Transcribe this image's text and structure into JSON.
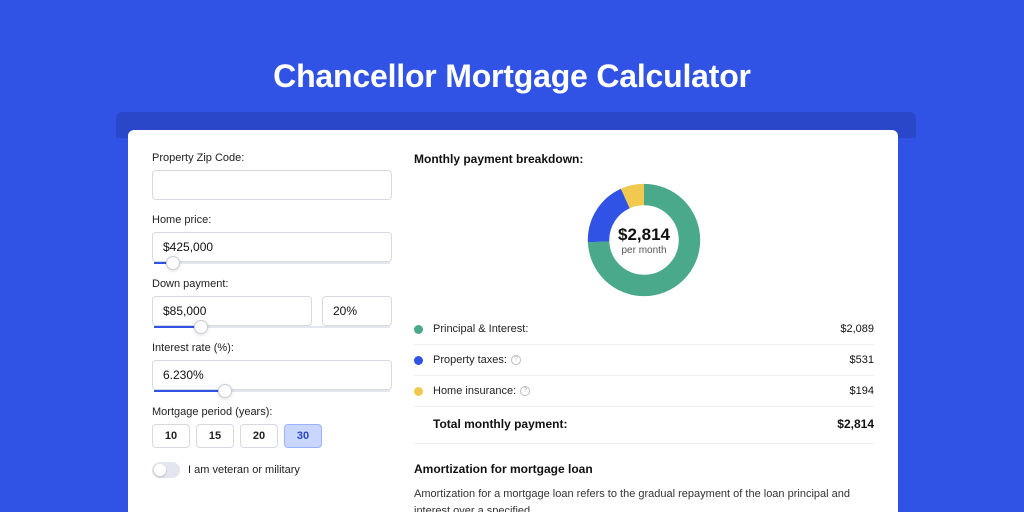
{
  "page": {
    "title": "Chancellor Mortgage Calculator"
  },
  "form": {
    "zip": {
      "label": "Property Zip Code:",
      "value": ""
    },
    "home_price": {
      "label": "Home price:",
      "value": "$425,000",
      "slider_pct": 8
    },
    "down_payment": {
      "label": "Down payment:",
      "amount": "$85,000",
      "percent": "20%",
      "slider_pct": 20
    },
    "interest_rate": {
      "label": "Interest rate (%):",
      "value": "6.230%",
      "slider_pct": 30
    },
    "period": {
      "label": "Mortgage period (years):",
      "options": [
        "10",
        "15",
        "20",
        "30"
      ],
      "selected": "30"
    },
    "veteran": {
      "label": "I am veteran or military",
      "on": false
    }
  },
  "breakdown": {
    "title": "Monthly payment breakdown:",
    "center_value": "$2,814",
    "center_sub": "per month",
    "items": [
      {
        "label": "Principal & Interest:",
        "amount": "$2,089",
        "color": "#49a98a",
        "info": false
      },
      {
        "label": "Property taxes:",
        "amount": "$531",
        "color": "#3053e6",
        "info": true
      },
      {
        "label": "Home insurance:",
        "amount": "$194",
        "color": "#f0c94e",
        "info": true
      }
    ],
    "total_label": "Total monthly payment:",
    "total_amount": "$2,814"
  },
  "amortization": {
    "title": "Amortization for mortgage loan",
    "text": "Amortization for a mortgage loan refers to the gradual repayment of the loan principal and interest over a specified"
  },
  "chart_data": {
    "type": "pie",
    "title": "Monthly payment breakdown",
    "series": [
      {
        "name": "Principal & Interest",
        "value": 2089,
        "color": "#49a98a"
      },
      {
        "name": "Property taxes",
        "value": 531,
        "color": "#3053e6"
      },
      {
        "name": "Home insurance",
        "value": 194,
        "color": "#f0c94e"
      }
    ],
    "total": 2814,
    "center_label": "$2,814 per month"
  }
}
